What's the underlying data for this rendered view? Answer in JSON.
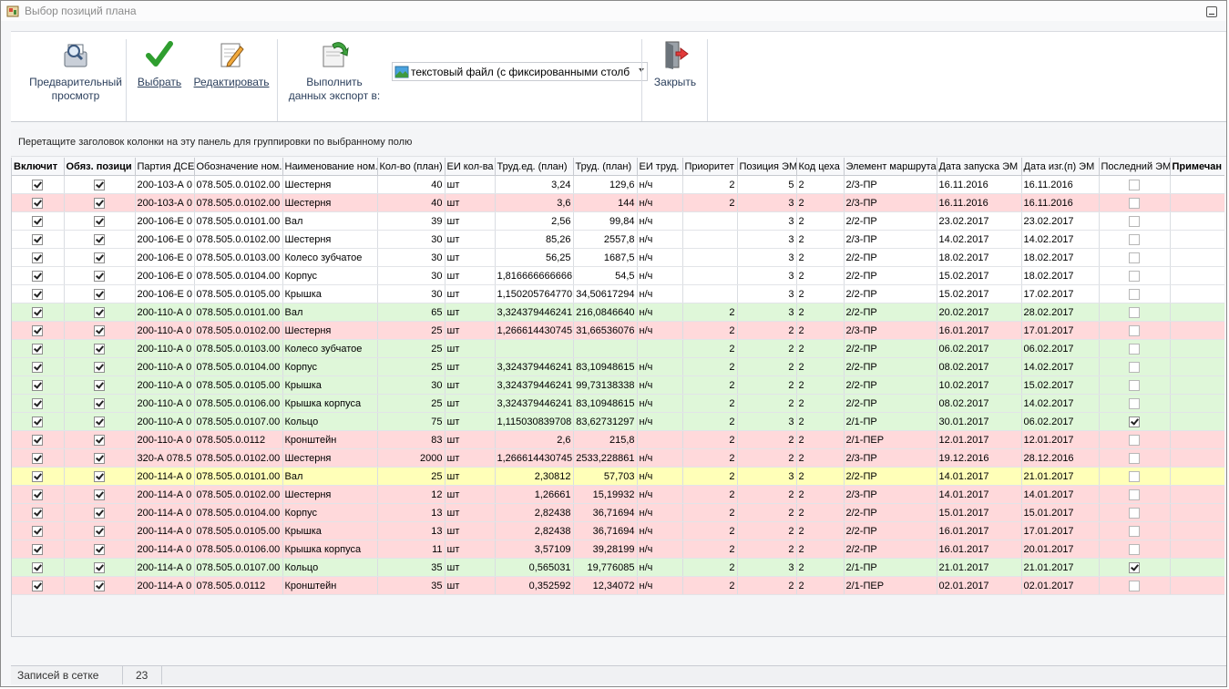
{
  "window": {
    "title": "Выбор позиций плана"
  },
  "toolbar": {
    "preview_line1": "Предварительный",
    "preview_line2": "просмотр",
    "select_label": "Выбрать",
    "edit_label": "Редактировать",
    "export_line1": "Выполнить",
    "export_line2": "данных экспорт в:",
    "export_format": "текстовый файл (с фиксированными столб",
    "close_label": "Закрыть"
  },
  "group_panel": {
    "hint": "Перетащите заголовок колонки на эту панель для группировки по выбранному полю"
  },
  "columns": [
    "Включит",
    "Обяз. позици",
    "Партия ДСЕ",
    "Обозначение ном.",
    "Наименование ном.",
    "Кол-во (план)",
    "ЕИ кол-ва",
    "Труд.ед. (план)",
    "Труд. (план)",
    "ЕИ труд.",
    "Приоритет",
    "Позиция ЭМ",
    "Код цеха",
    "Элемент маршрута",
    "Дата запуска ЭМ",
    "Дата изг.(п) ЭМ",
    "Последний ЭМ",
    "Примечан"
  ],
  "row_colors": {
    "white": "#ffffff",
    "pink": "#ffd9db",
    "green": "#dff7d9",
    "yellow": "#ffffb8"
  },
  "rows": [
    {
      "color": "white",
      "on": true,
      "req": true,
      "party": "200-103-А 0",
      "code": "078.505.0.0102.00",
      "name": "Шестерня",
      "qty": "40",
      "unit": "шт",
      "lab_unit": "3,24",
      "lab": "129,6",
      "lab_uom": "н/ч",
      "prio": "2",
      "pos": "5",
      "shop": "2",
      "route": "2/3-ПР",
      "start": "16.11.2016",
      "made": "16.11.2016",
      "last": false
    },
    {
      "color": "pink",
      "on": true,
      "req": true,
      "party": "200-103-А 0",
      "code": "078.505.0.0102.00",
      "name": "Шестерня",
      "qty": "40",
      "unit": "шт",
      "lab_unit": "3,6",
      "lab": "144",
      "lab_uom": "н/ч",
      "prio": "2",
      "pos": "3",
      "shop": "2",
      "route": "2/3-ПР",
      "start": "16.11.2016",
      "made": "16.11.2016",
      "last": false
    },
    {
      "color": "white",
      "on": true,
      "req": true,
      "party": "200-106-Е 0",
      "code": "078.505.0.0101.00",
      "name": "Вал",
      "qty": "39",
      "unit": "шт",
      "lab_unit": "2,56",
      "lab": "99,84",
      "lab_uom": "н/ч",
      "prio": "",
      "pos": "3",
      "shop": "2",
      "route": "2/2-ПР",
      "start": "23.02.2017",
      "made": "23.02.2017",
      "last": false
    },
    {
      "color": "white",
      "on": true,
      "req": true,
      "party": "200-106-Е 0",
      "code": "078.505.0.0102.00",
      "name": "Шестерня",
      "qty": "30",
      "unit": "шт",
      "lab_unit": "85,26",
      "lab": "2557,8",
      "lab_uom": "н/ч",
      "prio": "",
      "pos": "3",
      "shop": "2",
      "route": "2/3-ПР",
      "start": "14.02.2017",
      "made": "14.02.2017",
      "last": false
    },
    {
      "color": "white",
      "on": true,
      "req": true,
      "party": "200-106-Е 0",
      "code": "078.505.0.0103.00",
      "name": "Колесо зубчатое",
      "qty": "30",
      "unit": "шт",
      "lab_unit": "56,25",
      "lab": "1687,5",
      "lab_uom": "н/ч",
      "prio": "",
      "pos": "3",
      "shop": "2",
      "route": "2/2-ПР",
      "start": "18.02.2017",
      "made": "18.02.2017",
      "last": false
    },
    {
      "color": "white",
      "on": true,
      "req": true,
      "party": "200-106-Е 0",
      "code": "078.505.0.0104.00",
      "name": "Корпус",
      "qty": "30",
      "unit": "шт",
      "lab_unit": "1,816666666666",
      "lab": "54,5",
      "lab_uom": "н/ч",
      "prio": "",
      "pos": "3",
      "shop": "2",
      "route": "2/2-ПР",
      "start": "15.02.2017",
      "made": "18.02.2017",
      "last": false
    },
    {
      "color": "white",
      "on": true,
      "req": true,
      "party": "200-106-Е 0",
      "code": "078.505.0.0105.00",
      "name": "Крышка",
      "qty": "30",
      "unit": "шт",
      "lab_unit": "1,150205764770",
      "lab": "34,50617294",
      "lab_uom": "н/ч",
      "prio": "",
      "pos": "3",
      "shop": "2",
      "route": "2/2-ПР",
      "start": "15.02.2017",
      "made": "17.02.2017",
      "last": false
    },
    {
      "color": "green",
      "on": true,
      "req": true,
      "party": "200-110-А 0",
      "code": "078.505.0.0101.00",
      "name": "Вал",
      "qty": "65",
      "unit": "шт",
      "lab_unit": "3,324379446241",
      "lab": "216,0846640",
      "lab_uom": "н/ч",
      "prio": "2",
      "pos": "3",
      "shop": "2",
      "route": "2/2-ПР",
      "start": "20.02.2017",
      "made": "28.02.2017",
      "last": false
    },
    {
      "color": "pink",
      "on": true,
      "req": true,
      "party": "200-110-А 0",
      "code": "078.505.0.0102.00",
      "name": "Шестерня",
      "qty": "25",
      "unit": "шт",
      "lab_unit": "1,266614430745",
      "lab": "31,66536076",
      "lab_uom": "н/ч",
      "prio": "2",
      "pos": "2",
      "shop": "2",
      "route": "2/3-ПР",
      "start": "16.01.2017",
      "made": "17.01.2017",
      "last": false
    },
    {
      "color": "green",
      "on": true,
      "req": true,
      "party": "200-110-А 0",
      "code": "078.505.0.0103.00",
      "name": "Колесо зубчатое",
      "qty": "25",
      "unit": "шт",
      "lab_unit": "",
      "lab": "",
      "lab_uom": "",
      "prio": "2",
      "pos": "2",
      "shop": "2",
      "route": "2/2-ПР",
      "start": "06.02.2017",
      "made": "06.02.2017",
      "last": false
    },
    {
      "color": "green",
      "on": true,
      "req": true,
      "party": "200-110-А 0",
      "code": "078.505.0.0104.00",
      "name": "Корпус",
      "qty": "25",
      "unit": "шт",
      "lab_unit": "3,324379446241",
      "lab": "83,10948615",
      "lab_uom": "н/ч",
      "prio": "2",
      "pos": "2",
      "shop": "2",
      "route": "2/2-ПР",
      "start": "08.02.2017",
      "made": "14.02.2017",
      "last": false
    },
    {
      "color": "green",
      "on": true,
      "req": true,
      "party": "200-110-А 0",
      "code": "078.505.0.0105.00",
      "name": "Крышка",
      "qty": "30",
      "unit": "шт",
      "lab_unit": "3,324379446241",
      "lab": "99,73138338",
      "lab_uom": "н/ч",
      "prio": "2",
      "pos": "2",
      "shop": "2",
      "route": "2/2-ПР",
      "start": "10.02.2017",
      "made": "15.02.2017",
      "last": false
    },
    {
      "color": "green",
      "on": true,
      "req": true,
      "party": "200-110-А 0",
      "code": "078.505.0.0106.00",
      "name": "Крышка корпуса",
      "qty": "25",
      "unit": "шт",
      "lab_unit": "3,324379446241",
      "lab": "83,10948615",
      "lab_uom": "н/ч",
      "prio": "2",
      "pos": "2",
      "shop": "2",
      "route": "2/2-ПР",
      "start": "08.02.2017",
      "made": "14.02.2017",
      "last": false
    },
    {
      "color": "green",
      "on": true,
      "req": true,
      "party": "200-110-А 0",
      "code": "078.505.0.0107.00",
      "name": "Кольцо",
      "qty": "75",
      "unit": "шт",
      "lab_unit": "1,115030839708",
      "lab": "83,62731297",
      "lab_uom": "н/ч",
      "prio": "2",
      "pos": "3",
      "shop": "2",
      "route": "2/1-ПР",
      "start": "30.01.2017",
      "made": "06.02.2017",
      "last": true
    },
    {
      "color": "pink",
      "on": true,
      "req": true,
      "party": "200-110-А 0",
      "code": "078.505.0.0112",
      "name": "Кронштейн",
      "qty": "83",
      "unit": "шт",
      "lab_unit": "2,6",
      "lab": "215,8",
      "lab_uom": "",
      "prio": "2",
      "pos": "2",
      "shop": "2",
      "route": "2/1-ПЕР",
      "start": "12.01.2017",
      "made": "12.01.2017",
      "last": false
    },
    {
      "color": "pink",
      "on": true,
      "req": true,
      "party": "320-А 078.5",
      "code": "078.505.0.0102.00",
      "name": "Шестерня",
      "qty": "2000",
      "unit": "шт",
      "lab_unit": "1,266614430745",
      "lab": "2533,228861",
      "lab_uom": "н/ч",
      "prio": "2",
      "pos": "2",
      "shop": "2",
      "route": "2/3-ПР",
      "start": "19.12.2016",
      "made": "28.12.2016",
      "last": false
    },
    {
      "color": "yellow",
      "on": true,
      "req": true,
      "party": "200-114-А 0",
      "code": "078.505.0.0101.00",
      "name": "Вал",
      "qty": "25",
      "unit": "шт",
      "lab_unit": "2,30812",
      "lab": "57,703",
      "lab_uom": "н/ч",
      "prio": "2",
      "pos": "3",
      "shop": "2",
      "route": "2/2-ПР",
      "start": "14.01.2017",
      "made": "21.01.2017",
      "last": false
    },
    {
      "color": "pink",
      "on": true,
      "req": true,
      "party": "200-114-А 0",
      "code": "078.505.0.0102.00",
      "name": "Шестерня",
      "qty": "12",
      "unit": "шт",
      "lab_unit": "1,26661",
      "lab": "15,19932",
      "lab_uom": "н/ч",
      "prio": "2",
      "pos": "2",
      "shop": "2",
      "route": "2/3-ПР",
      "start": "14.01.2017",
      "made": "14.01.2017",
      "last": false
    },
    {
      "color": "pink",
      "on": true,
      "req": true,
      "party": "200-114-А 0",
      "code": "078.505.0.0104.00",
      "name": "Корпус",
      "qty": "13",
      "unit": "шт",
      "lab_unit": "2,82438",
      "lab": "36,71694",
      "lab_uom": "н/ч",
      "prio": "2",
      "pos": "2",
      "shop": "2",
      "route": "2/2-ПР",
      "start": "15.01.2017",
      "made": "15.01.2017",
      "last": false
    },
    {
      "color": "pink",
      "on": true,
      "req": true,
      "party": "200-114-А 0",
      "code": "078.505.0.0105.00",
      "name": "Крышка",
      "qty": "13",
      "unit": "шт",
      "lab_unit": "2,82438",
      "lab": "36,71694",
      "lab_uom": "н/ч",
      "prio": "2",
      "pos": "2",
      "shop": "2",
      "route": "2/2-ПР",
      "start": "16.01.2017",
      "made": "17.01.2017",
      "last": false
    },
    {
      "color": "pink",
      "on": true,
      "req": true,
      "party": "200-114-А 0",
      "code": "078.505.0.0106.00",
      "name": "Крышка корпуса",
      "qty": "11",
      "unit": "шт",
      "lab_unit": "3,57109",
      "lab": "39,28199",
      "lab_uom": "н/ч",
      "prio": "2",
      "pos": "2",
      "shop": "2",
      "route": "2/2-ПР",
      "start": "16.01.2017",
      "made": "20.01.2017",
      "last": false
    },
    {
      "color": "green",
      "on": true,
      "req": true,
      "party": "200-114-А 0",
      "code": "078.505.0.0107.00",
      "name": "Кольцо",
      "qty": "35",
      "unit": "шт",
      "lab_unit": "0,565031",
      "lab": "19,776085",
      "lab_uom": "н/ч",
      "prio": "2",
      "pos": "3",
      "shop": "2",
      "route": "2/1-ПР",
      "start": "21.01.2017",
      "made": "21.01.2017",
      "last": true
    },
    {
      "color": "pink",
      "on": true,
      "req": true,
      "party": "200-114-А 0",
      "code": "078.505.0.0112",
      "name": "Кронштейн",
      "qty": "35",
      "unit": "шт",
      "lab_unit": "0,352592",
      "lab": "12,34072",
      "lab_uom": "н/ч",
      "prio": "2",
      "pos": "2",
      "shop": "2",
      "route": "2/1-ПЕР",
      "start": "02.01.2017",
      "made": "02.01.2017",
      "last": false
    }
  ],
  "status": {
    "records_label": "Записей в сетке",
    "records_count": "23"
  }
}
